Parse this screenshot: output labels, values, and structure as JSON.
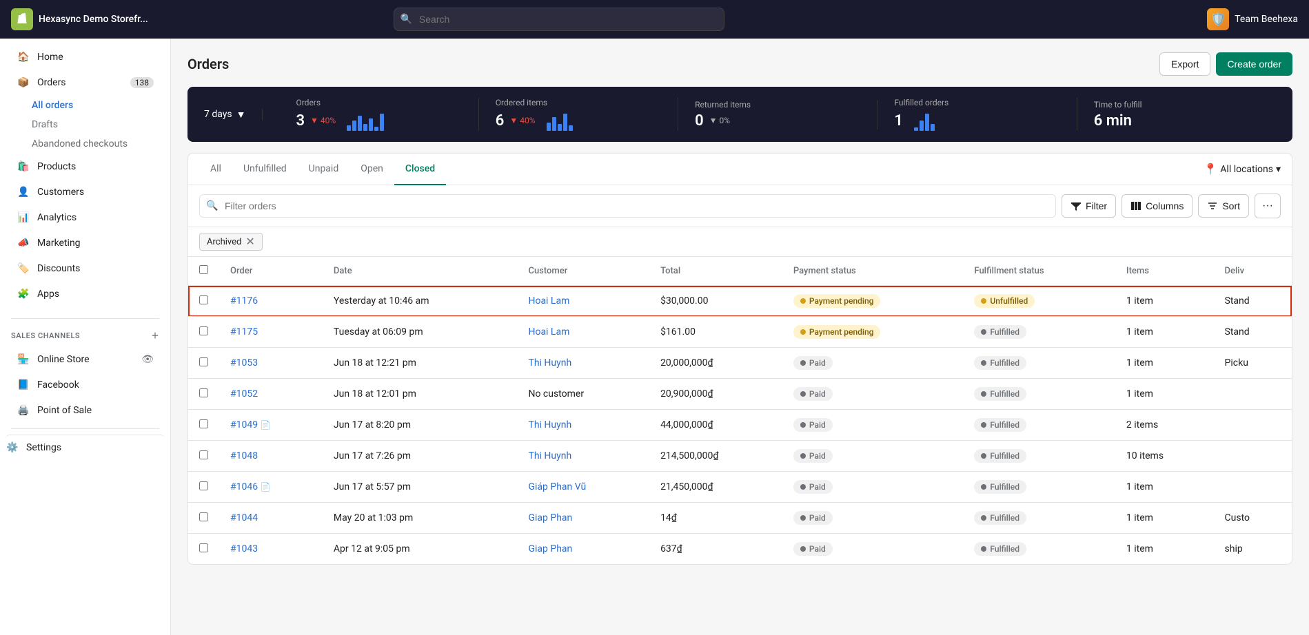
{
  "topbar": {
    "store_name": "Hexasync Demo Storefr...",
    "search_placeholder": "Search",
    "team_name": "Team Beehexa"
  },
  "sidebar": {
    "nav_items": [
      {
        "id": "home",
        "label": "Home",
        "icon": "home"
      },
      {
        "id": "orders",
        "label": "Orders",
        "icon": "orders",
        "badge": "138",
        "active": false
      },
      {
        "id": "products",
        "label": "Products",
        "icon": "products"
      },
      {
        "id": "customers",
        "label": "Customers",
        "icon": "customers"
      },
      {
        "id": "analytics",
        "label": "Analytics",
        "icon": "analytics"
      },
      {
        "id": "marketing",
        "label": "Marketing",
        "icon": "marketing"
      },
      {
        "id": "discounts",
        "label": "Discounts",
        "icon": "discounts"
      },
      {
        "id": "apps",
        "label": "Apps",
        "icon": "apps"
      }
    ],
    "orders_sub": [
      {
        "id": "all-orders",
        "label": "All orders",
        "active": true
      },
      {
        "id": "drafts",
        "label": "Drafts"
      },
      {
        "id": "abandoned",
        "label": "Abandoned checkouts"
      }
    ],
    "sales_channels_label": "SALES CHANNELS",
    "sales_channels": [
      {
        "id": "online-store",
        "label": "Online Store",
        "icon": "store"
      },
      {
        "id": "facebook",
        "label": "Facebook",
        "icon": "facebook"
      },
      {
        "id": "pos",
        "label": "Point of Sale",
        "icon": "pos"
      }
    ],
    "settings_label": "Settings"
  },
  "page": {
    "title": "Orders",
    "export_label": "Export",
    "create_order_label": "Create order"
  },
  "stats": {
    "period_label": "7 days",
    "metrics": [
      {
        "label": "Orders",
        "value": "3",
        "change": "40%",
        "direction": "down",
        "has_chart": true
      },
      {
        "label": "Ordered items",
        "value": "6",
        "change": "40%",
        "direction": "down",
        "has_chart": true
      },
      {
        "label": "Returned items",
        "value": "0",
        "change": "0%",
        "direction": "neutral",
        "has_chart": false
      },
      {
        "label": "Fulfilled orders",
        "value": "1",
        "change": "",
        "direction": "none",
        "has_chart": true
      },
      {
        "label": "Time to fulfill",
        "value": "6 min",
        "change": "",
        "direction": "none",
        "has_chart": false
      }
    ]
  },
  "orders": {
    "tabs": [
      {
        "id": "all",
        "label": "All"
      },
      {
        "id": "unfulfilled",
        "label": "Unfulfilled"
      },
      {
        "id": "unpaid",
        "label": "Unpaid"
      },
      {
        "id": "open",
        "label": "Open"
      },
      {
        "id": "closed",
        "label": "Closed",
        "active": true
      }
    ],
    "location_label": "All locations",
    "filter_placeholder": "Filter orders",
    "filter_btn": "Filter",
    "columns_btn": "Columns",
    "sort_btn": "Sort",
    "active_filters": [
      {
        "id": "archived",
        "label": "Archived"
      }
    ],
    "columns": [
      "Order",
      "Date",
      "Customer",
      "Total",
      "Payment status",
      "Fulfillment status",
      "Items",
      "Deliv"
    ],
    "rows": [
      {
        "id": "1176",
        "order": "#1176",
        "date": "Yesterday at 10:46 am",
        "customer": "Hoai Lam",
        "total": "$30,000.00",
        "payment_status": "Payment pending",
        "payment_badge": "yellow",
        "fulfillment_status": "Unfulfilled",
        "fulfillment_badge": "yellow",
        "items": "1 item",
        "delivery": "Stand",
        "has_doc": false,
        "highlighted": true
      },
      {
        "id": "1175",
        "order": "#1175",
        "date": "Tuesday at 06:09 pm",
        "customer": "Hoai Lam",
        "total": "$161.00",
        "payment_status": "Payment pending",
        "payment_badge": "yellow",
        "fulfillment_status": "Fulfilled",
        "fulfillment_badge": "gray",
        "items": "1 item",
        "delivery": "Stand",
        "has_doc": false,
        "highlighted": false
      },
      {
        "id": "1053",
        "order": "#1053",
        "date": "Jun 18 at 12:21 pm",
        "customer": "Thi Huynh",
        "total": "20,000,000₫",
        "payment_status": "Paid",
        "payment_badge": "gray",
        "fulfillment_status": "Fulfilled",
        "fulfillment_badge": "gray",
        "items": "1 item",
        "delivery": "Picku",
        "has_doc": false,
        "highlighted": false
      },
      {
        "id": "1052",
        "order": "#1052",
        "date": "Jun 18 at 12:01 pm",
        "customer": "No customer",
        "total": "20,900,000₫",
        "payment_status": "Paid",
        "payment_badge": "gray",
        "fulfillment_status": "Fulfilled",
        "fulfillment_badge": "gray",
        "items": "1 item",
        "delivery": "",
        "has_doc": false,
        "highlighted": false
      },
      {
        "id": "1049",
        "order": "#1049",
        "date": "Jun 17 at 8:20 pm",
        "customer": "Thi Huynh",
        "total": "44,000,000₫",
        "payment_status": "Paid",
        "payment_badge": "gray",
        "fulfillment_status": "Fulfilled",
        "fulfillment_badge": "gray",
        "items": "2 items",
        "delivery": "",
        "has_doc": true,
        "highlighted": false
      },
      {
        "id": "1048",
        "order": "#1048",
        "date": "Jun 17 at 7:26 pm",
        "customer": "Thi Huynh",
        "total": "214,500,000₫",
        "payment_status": "Paid",
        "payment_badge": "gray",
        "fulfillment_status": "Fulfilled",
        "fulfillment_badge": "gray",
        "items": "10 items",
        "delivery": "",
        "has_doc": false,
        "highlighted": false
      },
      {
        "id": "1046",
        "order": "#1046",
        "date": "Jun 17 at 5:57 pm",
        "customer": "Giáp Phan Vũ",
        "total": "21,450,000₫",
        "payment_status": "Paid",
        "payment_badge": "gray",
        "fulfillment_status": "Fulfilled",
        "fulfillment_badge": "gray",
        "items": "1 item",
        "delivery": "",
        "has_doc": true,
        "highlighted": false
      },
      {
        "id": "1044",
        "order": "#1044",
        "date": "May 20 at 1:03 pm",
        "customer": "Giap Phan",
        "total": "14₫",
        "payment_status": "Paid",
        "payment_badge": "gray",
        "fulfillment_status": "Fulfilled",
        "fulfillment_badge": "gray",
        "items": "1 item",
        "delivery": "Custo",
        "has_doc": false,
        "highlighted": false
      },
      {
        "id": "1043",
        "order": "#1043",
        "date": "Apr 12 at 9:05 pm",
        "customer": "Giap Phan",
        "total": "637₫",
        "payment_status": "Paid",
        "payment_badge": "gray",
        "fulfillment_status": "Fulfilled",
        "fulfillment_badge": "gray",
        "items": "1 item",
        "delivery": "ship",
        "has_doc": false,
        "highlighted": false
      }
    ]
  }
}
